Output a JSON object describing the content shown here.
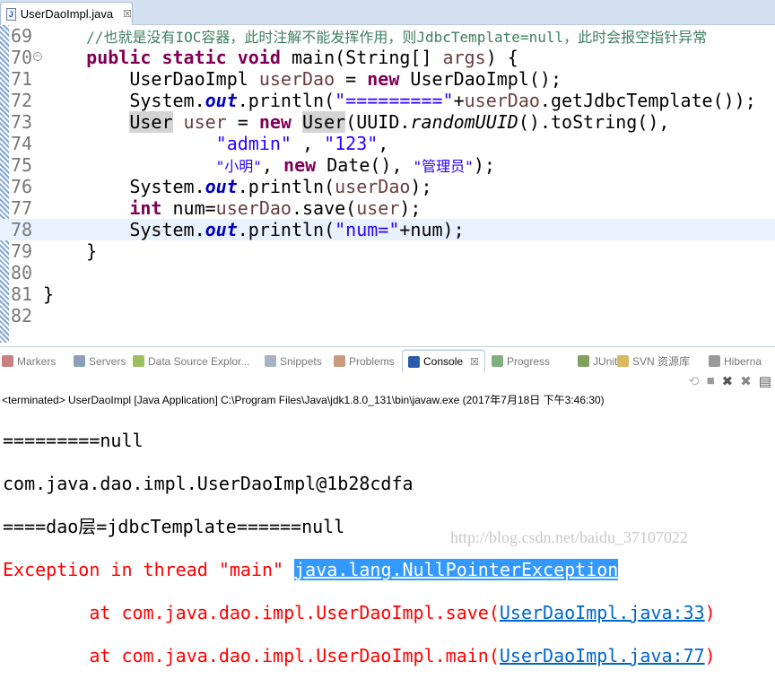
{
  "editor_tab": {
    "title": "UserDaoImpl.java",
    "close": "☒"
  },
  "code_lines": [
    {
      "n": "69",
      "tokens": [
        {
          "t": "    "
        },
        {
          "t": "//也就是没有IOC容器，此时注解不能发挥作用，则JdbcTemplate=null，此时会报空指针异常",
          "c": "cm"
        }
      ]
    },
    {
      "n": "70",
      "fold": true,
      "tokens": [
        {
          "t": "    "
        },
        {
          "t": "public static void",
          "c": "kw"
        },
        {
          "t": " main(String[] "
        },
        {
          "t": "args",
          "c": "var"
        },
        {
          "t": ") {"
        }
      ]
    },
    {
      "n": "71",
      "tokens": [
        {
          "t": "        UserDaoImpl "
        },
        {
          "t": "userDao",
          "c": "var"
        },
        {
          "t": " = "
        },
        {
          "t": "new",
          "c": "kw"
        },
        {
          "t": " UserDaoImpl();"
        }
      ]
    },
    {
      "n": "72",
      "tokens": [
        {
          "t": "        System."
        },
        {
          "t": "out",
          "c": "fld"
        },
        {
          "t": ".println("
        },
        {
          "t": "\"=========\"",
          "c": "str"
        },
        {
          "t": "+"
        },
        {
          "t": "userDao",
          "c": "var"
        },
        {
          "t": ".getJdbcTemplate());"
        }
      ]
    },
    {
      "n": "73",
      "tokens": [
        {
          "t": "        "
        },
        {
          "t": "User",
          "c": "occ"
        },
        {
          "t": " "
        },
        {
          "t": "user",
          "c": "var"
        },
        {
          "t": " = "
        },
        {
          "t": "new",
          "c": "kw"
        },
        {
          "t": " "
        },
        {
          "t": "User",
          "c": "occ"
        },
        {
          "t": "(UUID."
        },
        {
          "t": "randomUUID",
          "c": "sm"
        },
        {
          "t": "().toString(),"
        }
      ]
    },
    {
      "n": "74",
      "tokens": [
        {
          "t": "                "
        },
        {
          "t": "\"admin\"",
          "c": "str"
        },
        {
          "t": " , "
        },
        {
          "t": "\"123\"",
          "c": "str"
        },
        {
          "t": ","
        }
      ]
    },
    {
      "n": "75",
      "tokens": [
        {
          "t": "                "
        },
        {
          "t": "\"小明\"",
          "c": "str"
        },
        {
          "t": ", "
        },
        {
          "t": "new",
          "c": "kw"
        },
        {
          "t": " Date(), "
        },
        {
          "t": "\"管理员\"",
          "c": "str"
        },
        {
          "t": ");"
        }
      ]
    },
    {
      "n": "76",
      "tokens": [
        {
          "t": "        System."
        },
        {
          "t": "out",
          "c": "fld"
        },
        {
          "t": ".println("
        },
        {
          "t": "userDao",
          "c": "var"
        },
        {
          "t": ");"
        }
      ]
    },
    {
      "n": "77",
      "tokens": [
        {
          "t": "        "
        },
        {
          "t": "int",
          "c": "kw"
        },
        {
          "t": " num="
        },
        {
          "t": "userDao",
          "c": "var"
        },
        {
          "t": ".save("
        },
        {
          "t": "user",
          "c": "var"
        },
        {
          "t": ");"
        }
      ]
    },
    {
      "n": "78",
      "current": true,
      "tokens": [
        {
          "t": "        System."
        },
        {
          "t": "out",
          "c": "fld"
        },
        {
          "t": ".println("
        },
        {
          "t": "\"num=\"",
          "c": "str"
        },
        {
          "t": "+num);"
        }
      ]
    },
    {
      "n": "79",
      "tokens": [
        {
          "t": "    }"
        }
      ]
    },
    {
      "n": "80",
      "tokens": []
    },
    {
      "n": "81",
      "tokens": [
        {
          "t": "}"
        }
      ]
    },
    {
      "n": "82",
      "tokens": []
    }
  ],
  "views_tabs": [
    {
      "label": "Markers",
      "icon": "markers-icon",
      "color": "#c98080"
    },
    {
      "label": "Servers",
      "icon": "servers-icon",
      "color": "#8aa0b8"
    },
    {
      "label": "Data Source Explor...",
      "icon": "data-source-icon",
      "color": "#9cbf60"
    },
    {
      "label": "Snippets",
      "icon": "snippets-icon",
      "color": "#a8b4c4"
    },
    {
      "label": "Problems",
      "icon": "problems-icon",
      "color": "#c99a80"
    },
    {
      "label": "Console",
      "icon": "console-icon",
      "color": "#2a5caa",
      "active": true
    },
    {
      "label": "Progress",
      "icon": "progress-icon",
      "color": "#80b080"
    },
    {
      "label": "JUnit",
      "icon": "junit-icon",
      "color": "#80a060"
    },
    {
      "label": "SVN 资源库",
      "icon": "svn-icon",
      "color": "#d8b860"
    },
    {
      "label": "Hiberna",
      "icon": "hibernate-icon",
      "color": "#999"
    }
  ],
  "console": {
    "status": "<terminated> UserDaoImpl [Java Application] C:\\Program Files\\Java\\jdk1.8.0_131\\bin\\javaw.exe (2017年7月18日 下午3:46:30)",
    "out1": "=========null",
    "out2": "com.java.dao.impl.UserDaoImpl@1b28cdfa",
    "out3": "====dao层=jdbcTemplate======null",
    "exc_prefix": "Exception in thread \"main\" ",
    "exc_class": "java.lang.NullPointerException",
    "st1_prefix": "        at com.java.dao.impl.UserDaoImpl.save(",
    "st1_link": "UserDaoImpl.java:33",
    "st2_prefix": "        at com.java.dao.impl.UserDaoImpl.main(",
    "st2_link": "UserDaoImpl.java:77",
    "close_paren": ")"
  },
  "watermark": "http://blog.csdn.net/baidu_37107022"
}
